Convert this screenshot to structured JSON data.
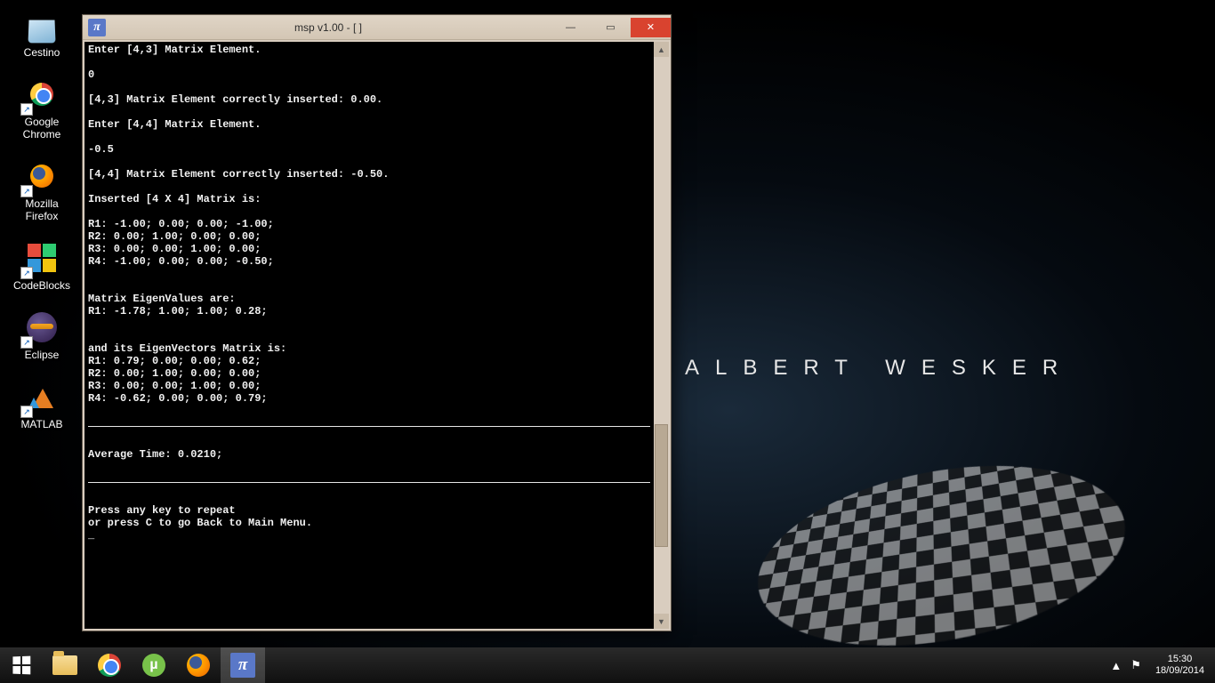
{
  "wallpaper": {
    "text": "ALBERT WESKER"
  },
  "desktop_icons": [
    {
      "name": "recycle-bin",
      "label": "Cestino",
      "glyph": "recycle"
    },
    {
      "name": "google-chrome",
      "label": "Google\nChrome",
      "glyph": "chrome"
    },
    {
      "name": "mozilla-firefox",
      "label": "Mozilla\nFirefox",
      "glyph": "firefox"
    },
    {
      "name": "codeblocks",
      "label": "CodeBlocks",
      "glyph": "cb"
    },
    {
      "name": "eclipse",
      "label": "Eclipse",
      "glyph": "eclipse"
    },
    {
      "name": "matlab",
      "label": "MATLAB",
      "glyph": "matlab"
    }
  ],
  "window": {
    "title": "msp v1.00 - [  ]",
    "app_icon_glyph": "π",
    "controls": {
      "minimize": "—",
      "maximize": "▭",
      "close": "✕"
    }
  },
  "console": {
    "lines_top": "Enter [4,3] Matrix Element.\n\n0\n\n[4,3] Matrix Element correctly inserted: 0.00.\n\nEnter [4,4] Matrix Element.\n\n-0.5\n\n[4,4] Matrix Element correctly inserted: -0.50.\n\nInserted [4 X 4] Matrix is:\n\nR1: -1.00; 0.00; 0.00; -1.00;\nR2: 0.00; 1.00; 0.00; 0.00;\nR3: 0.00; 0.00; 1.00; 0.00;\nR4: -1.00; 0.00; 0.00; -0.50;\n\n\nMatrix EigenValues are:\nR1: -1.78; 1.00; 1.00; 0.28;\n\n\nand its EigenVectors Matrix is:\nR1: 0.79; 0.00; 0.00; 0.62;\nR2: 0.00; 1.00; 0.00; 0.00;\nR3: 0.00; 0.00; 1.00; 0.00;\nR4: -0.62; 0.00; 0.00; 0.79;\n\n",
    "lines_mid": "\nAverage Time: 0.0210;\n\n",
    "lines_bot": "\nPress any key to repeat\nor press C to go Back to Main Menu.\n_"
  },
  "taskbar": {
    "items": [
      {
        "name": "file-explorer",
        "glyph": "folder",
        "active": false
      },
      {
        "name": "google-chrome",
        "glyph": "chrome",
        "active": false
      },
      {
        "name": "utorrent",
        "glyph": "utorrent",
        "active": false
      },
      {
        "name": "mozilla-firefox",
        "glyph": "firefox",
        "active": false
      },
      {
        "name": "msp-app",
        "glyph": "pi",
        "active": true
      }
    ],
    "tray": {
      "show_hidden": "▲",
      "flag": "⚑",
      "time": "15:30",
      "date": "18/09/2014"
    }
  }
}
